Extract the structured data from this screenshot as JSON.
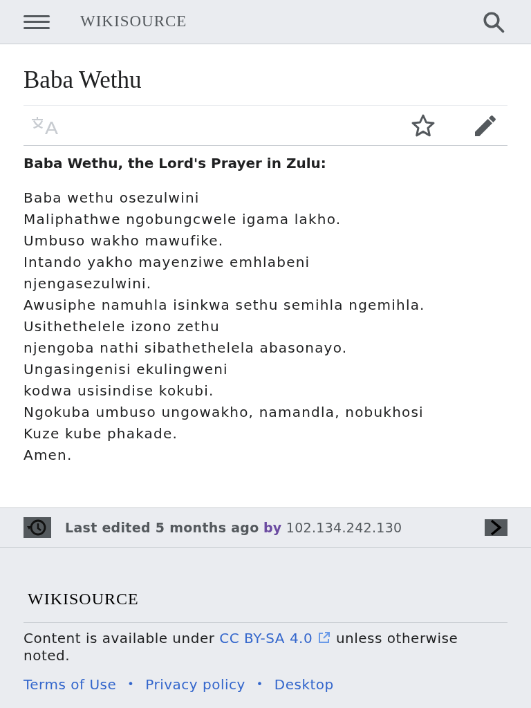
{
  "header": {
    "wordmark": "WIKISOURCE"
  },
  "page": {
    "title": "Baba Wethu",
    "heading": "Baba Wethu, the Lord's Prayer in Zulu:",
    "lines": [
      "Baba wethu osezulwini",
      "Maliphathwe ngobungcwele igama lakho.",
      "Umbuso wakho mawufike.",
      "Intando yakho mayenziwe emhlabeni",
      "njengasezulwini.",
      "Awusiphe namuhla isinkwa sethu semihla ngemihla.",
      "Usithethelele izono zethu",
      "njengoba nathi sibathethelela abasonayo.",
      "Ungasingenisi ekulingweni",
      "kodwa usisindise kokubi.",
      "Ngokuba umbuso ungowakho, namandla, nobukhosi",
      "Kuze kube phakade.",
      "Amen."
    ]
  },
  "last_edited": {
    "text": "Last edited 5 months ago",
    "by": "by",
    "user": "102.134.242.130"
  },
  "footer": {
    "wordmark": "WIKISOURCE",
    "license_before": "Content is available under",
    "license_link": "CC BY-SA 4.0",
    "license_after": "unless otherwise noted.",
    "links": [
      {
        "label": "Terms of Use"
      },
      {
        "label": "Privacy policy"
      },
      {
        "label": "Desktop"
      }
    ],
    "separator": "•"
  }
}
